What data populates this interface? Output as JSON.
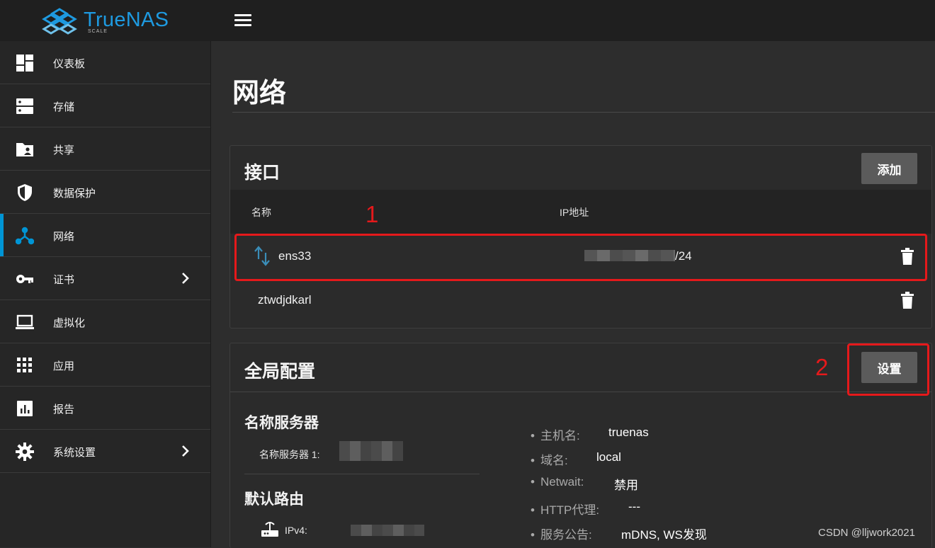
{
  "header": {
    "brand": "TrueNAS",
    "edition": "SCALE"
  },
  "sidebar": {
    "items": [
      {
        "label": "仪表板",
        "icon": "dashboard-icon"
      },
      {
        "label": "存储",
        "icon": "storage-icon"
      },
      {
        "label": "共享",
        "icon": "shares-folder-icon"
      },
      {
        "label": "数据保护",
        "icon": "shield-icon"
      },
      {
        "label": "网络",
        "icon": "network-icon",
        "active": true
      },
      {
        "label": "证书",
        "icon": "key-icon",
        "expandable": true
      },
      {
        "label": "虚拟化",
        "icon": "laptop-icon"
      },
      {
        "label": "应用",
        "icon": "apps-grid-icon"
      },
      {
        "label": "报告",
        "icon": "reports-chart-icon"
      },
      {
        "label": "系统设置",
        "icon": "gear-icon",
        "expandable": true
      }
    ]
  },
  "page": {
    "title": "网络"
  },
  "interfaces": {
    "title": "接口",
    "add_label": "添加",
    "columns": {
      "name": "名称",
      "ip": "IP地址"
    },
    "rows": [
      {
        "name": "ens33",
        "ip_suffix": "/24"
      },
      {
        "name": "ztwdjdkarl",
        "ip_suffix": ""
      }
    ]
  },
  "global": {
    "title": "全局配置",
    "settings_label": "设置",
    "nameservers_heading": "名称服务器",
    "nameserver1_label": "名称服务器 1:",
    "default_route_heading": "默认路由",
    "ipv4_label": "IPv4:",
    "info": [
      {
        "key": "主机名:",
        "value": "truenas"
      },
      {
        "key": "域名:",
        "value": "local"
      },
      {
        "key": "Netwait:",
        "value": "禁用"
      },
      {
        "key": "HTTP代理:",
        "value": "---"
      },
      {
        "key": "服务公告:",
        "value": "mDNS, WS发现"
      }
    ]
  },
  "annotations": {
    "marker1": "1",
    "marker2": "2"
  },
  "watermark": "CSDN @lljwork2021",
  "colors": {
    "accent": "#0095d5",
    "brand": "#1e9ae0",
    "annotation_red": "#e5191b"
  }
}
